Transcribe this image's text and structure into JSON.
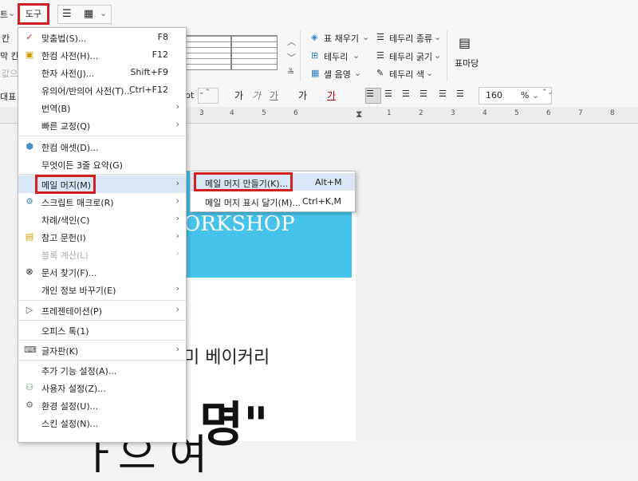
{
  "toolbar": {
    "left_arrow": "트",
    "tools_label": "도구"
  },
  "ribbon": {
    "left_labels": [
      "칸",
      "막 칸",
      "값으"
    ],
    "cell_fill": "표 채우기",
    "border": "테두리",
    "cell_color": "셀 음영",
    "border_type": "테두리 종류",
    "border_width": "테두리 굵기",
    "border_color": "테두리 색",
    "table_props": "표마당"
  },
  "format_bar": {
    "style": "대표",
    "size_unit": "pt",
    "font_buttons": [
      "가",
      "가",
      "가",
      "가",
      "가"
    ],
    "zoom_value": "160",
    "zoom_unit": "%"
  },
  "ruler": {
    "numbers": [
      "3",
      "4",
      "5",
      "6",
      "1",
      "2",
      "3",
      "4",
      "5",
      "6",
      "7",
      "8"
    ]
  },
  "menu": {
    "items": [
      {
        "label": "맞춤법(S)...",
        "shortcut": "F8",
        "icon": "spellcheck-icon"
      },
      {
        "label": "한컴 사전(H)...",
        "shortcut": "F12",
        "icon": "dictionary-icon"
      },
      {
        "label": "한자 사전(J)...",
        "shortcut": "Shift+F9",
        "icon": ""
      },
      {
        "label": "유의어/반의어 사전(T)...",
        "shortcut": "Ctrl+F12",
        "icon": ""
      },
      {
        "label": "번역(B)",
        "shortcut": "",
        "icon": "",
        "submenu": true
      },
      {
        "label": "빠른 교정(Q)",
        "shortcut": "",
        "icon": "",
        "submenu": true
      },
      {
        "label": "한컴 애셋(D)...",
        "shortcut": "",
        "icon": "asset-icon"
      },
      {
        "label": "무엇이든 3줄 요약(G)",
        "shortcut": "",
        "icon": ""
      },
      {
        "label": "메일 머지(M)",
        "shortcut": "",
        "icon": "",
        "submenu": true
      },
      {
        "label": "스크립트 매크로(R)",
        "shortcut": "",
        "icon": "macro-icon",
        "submenu": true
      },
      {
        "label": "차례/색인(C)",
        "shortcut": "",
        "icon": "",
        "submenu": true
      },
      {
        "label": "참고 문헌(I)",
        "shortcut": "",
        "icon": "reference-icon",
        "submenu": true
      },
      {
        "label": "블록 계산(L)",
        "shortcut": "",
        "icon": "",
        "submenu": true,
        "disabled": true
      },
      {
        "label": "문서 찾기(F)...",
        "shortcut": "",
        "icon": "binoculars-icon"
      },
      {
        "label": "개인 정보 바꾸기(E)",
        "shortcut": "",
        "icon": "",
        "submenu": true
      },
      {
        "label": "프레젠테이션(P)",
        "shortcut": "",
        "icon": "presentation-icon",
        "submenu": true
      },
      {
        "label": "오피스 톡(1)",
        "shortcut": "",
        "icon": ""
      },
      {
        "label": "글자판(K)",
        "shortcut": "",
        "icon": "keyboard-icon",
        "submenu": true
      },
      {
        "label": "추가 기능 설정(A)...",
        "shortcut": "",
        "icon": ""
      },
      {
        "label": "사용자 설정(Z)...",
        "shortcut": "",
        "icon": "user-icon"
      },
      {
        "label": "환경 설정(U)...",
        "shortcut": "",
        "icon": "gear-icon"
      },
      {
        "label": "스킨 설정(N)...",
        "shortcut": "",
        "icon": ""
      }
    ]
  },
  "submenu": {
    "items": [
      {
        "label": "메일 머지 만들기(K)...",
        "shortcut": "Alt+M"
      },
      {
        "label": "메일 머지 표시 달기(M)...",
        "shortcut": "Ctrl+K,M"
      }
    ]
  },
  "document": {
    "banner_text": "ORKSHOP",
    "bakery_text": "미 베이커리",
    "big_text": "명\"",
    "big_text2": "ㅏ으 여"
  },
  "colors": {
    "highlight_red": "#d21f1f",
    "banner_blue": "#45c3ea"
  }
}
